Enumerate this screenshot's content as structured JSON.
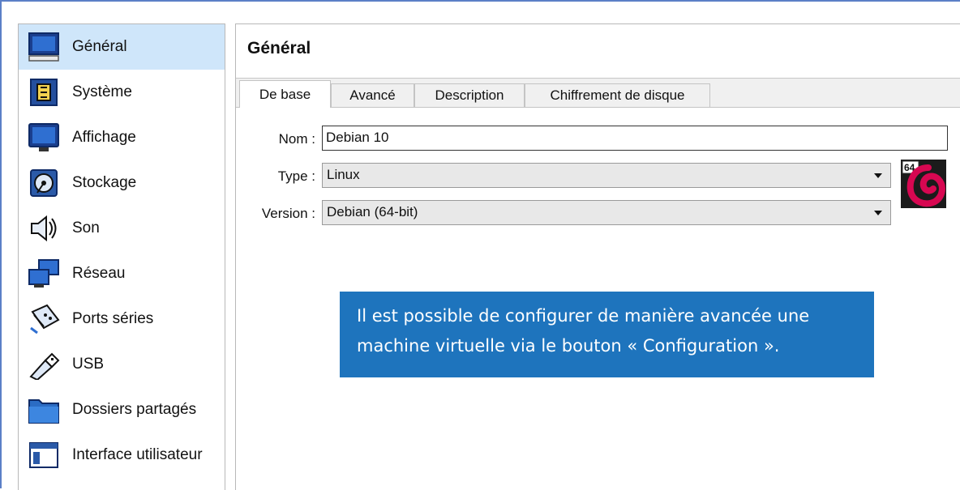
{
  "sidebar": {
    "items": [
      {
        "label": "Général",
        "icon": "general-monitor-icon"
      },
      {
        "label": "Système",
        "icon": "chip-icon"
      },
      {
        "label": "Affichage",
        "icon": "display-icon"
      },
      {
        "label": "Stockage",
        "icon": "storage-disk-icon"
      },
      {
        "label": "Son",
        "icon": "speaker-icon"
      },
      {
        "label": "Réseau",
        "icon": "network-icon"
      },
      {
        "label": "Ports séries",
        "icon": "serial-port-icon"
      },
      {
        "label": "USB",
        "icon": "usb-icon"
      },
      {
        "label": "Dossiers partagés",
        "icon": "folder-icon"
      },
      {
        "label": "Interface utilisateur",
        "icon": "window-ui-icon"
      }
    ],
    "selected": "Général"
  },
  "main": {
    "title": "Général",
    "tabs": [
      {
        "label": "De base",
        "active": true
      },
      {
        "label": "Avancé",
        "active": false
      },
      {
        "label": "Description",
        "active": false
      },
      {
        "label": "Chiffrement de disque",
        "active": false
      }
    ],
    "fields": {
      "name_label": "Nom :",
      "name_value": "Debian 10",
      "type_label": "Type :",
      "type_value": "Linux",
      "version_label": "Version :",
      "version_value": "Debian (64-bit)"
    },
    "os_badge": {
      "text": "64",
      "icon": "debian-logo-icon"
    }
  },
  "note": {
    "text": "Il est possible de configurer de manière avancée une machine virtuelle via le bouton « Configuration ».",
    "background": "#1e74bd"
  },
  "colors": {
    "selected_bg": "#cfe6fa",
    "frame_border": "#5b7fc7"
  }
}
